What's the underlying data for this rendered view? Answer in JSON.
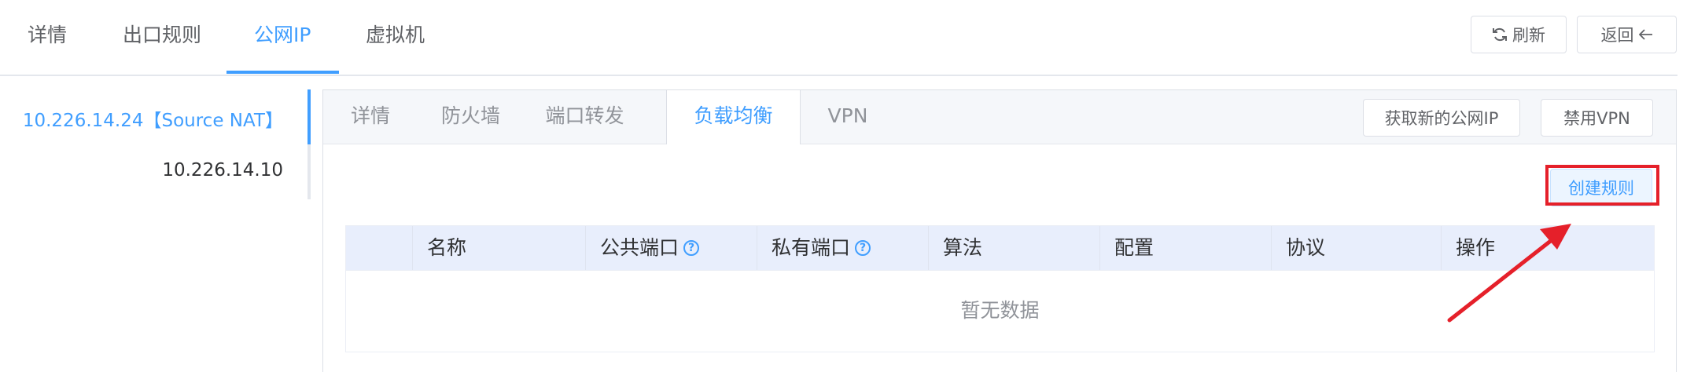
{
  "top_tabs": [
    "详情",
    "出口规则",
    "公网IP",
    "虚拟机"
  ],
  "top_active_tab": "公网IP",
  "header_buttons": {
    "refresh": "刷新",
    "back": "返回"
  },
  "ip_list": [
    "10.226.14.24【Source NAT】",
    "10.226.14.10"
  ],
  "inner_tabs": [
    "详情",
    "防火墙",
    "端口转发",
    "负载均衡",
    "VPN"
  ],
  "inner_active_tab": "负载均衡",
  "inner_buttons": {
    "acquire_ip": "获取新的公网IP",
    "disable_vpn": "禁用VPN"
  },
  "create_rule": "创建规则",
  "table": {
    "columns": [
      "名称",
      "公共端口",
      "私有端口",
      "算法",
      "配置",
      "协议",
      "操作"
    ],
    "empty_text": "暂无数据"
  },
  "colors": {
    "accent": "#409eff",
    "annotation": "#e5202a"
  }
}
